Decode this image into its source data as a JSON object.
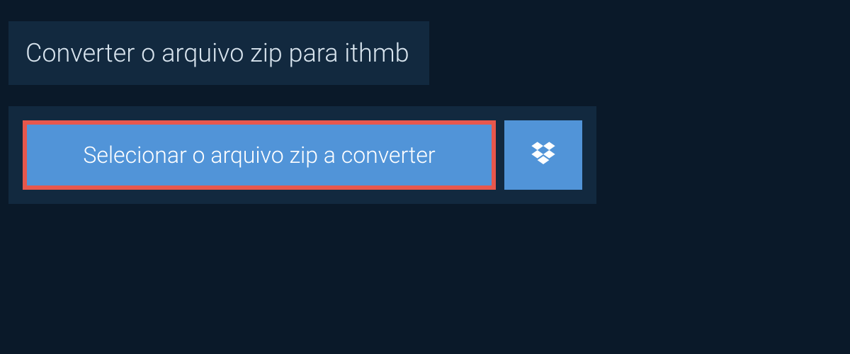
{
  "title": "Converter o arquivo zip para ithmb",
  "select_button_label": "Selecionar o arquivo zip a converter"
}
